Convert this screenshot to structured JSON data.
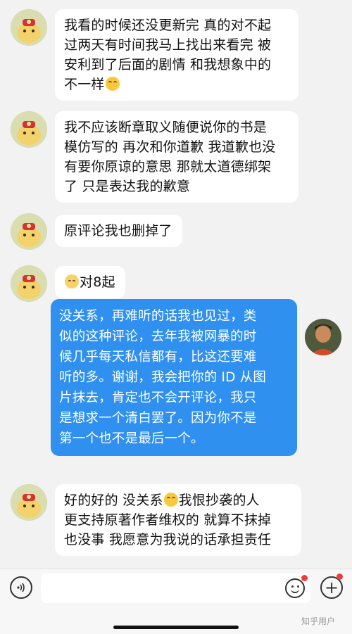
{
  "messages": [
    {
      "sender": "other",
      "lines": [
        "我看的时候还没更新完 真的对不起",
        "过两天有时间我马上找出来看完 被",
        "安利到了后面的剧情 和我想象中的",
        "不一样"
      ],
      "trailing_emoji": "crying-laughing-emoji"
    },
    {
      "sender": "other",
      "lines": [
        "我不应该断章取义随便说你的书是",
        "模仿写的 再次和你道歉 我道歉也没",
        "有要你原谅的意思 那就太道德绑架",
        "了 只是表达我的歉意"
      ]
    },
    {
      "sender": "other",
      "lines": [
        "原评论我也删掉了"
      ]
    },
    {
      "sender": "other",
      "leading_emoji": "sad-face-emoji",
      "lines": [
        "对8起"
      ]
    },
    {
      "sender": "me",
      "lines": [
        "没关系，再难听的话我也见过，类",
        "似的这种评论，去年我被网暴的时",
        "候几乎每天私信都有，比这还要难",
        "听的多。谢谢，我会把你的 ID 从图",
        "片抹去，肯定也不会开评论，我只",
        "是想求一个清白罢了。因为你不是",
        "第一个也不是最后一个。"
      ]
    },
    {
      "sender": "other",
      "line1_before_emoji": "好的好的 没关系",
      "inline_emoji": "crying-laughing-emoji",
      "line1_after_emoji": "我恨抄袭的人",
      "lines": [
        "更支持原著作者维权的 就算不抹掉",
        "也没事 我愿意为我说的话承担责任"
      ]
    }
  ],
  "input_bar": {
    "placeholder": "",
    "voice_icon": "voice-icon",
    "emoji_icon": "emoji-icon",
    "add_icon": "plus-icon"
  },
  "watermark": "知乎用户",
  "colors": {
    "outgoing_bubble": "#2f90f0",
    "incoming_bubble": "#ffffff",
    "background": "#f2f2f2",
    "notification_dot": "#f23c3c"
  }
}
